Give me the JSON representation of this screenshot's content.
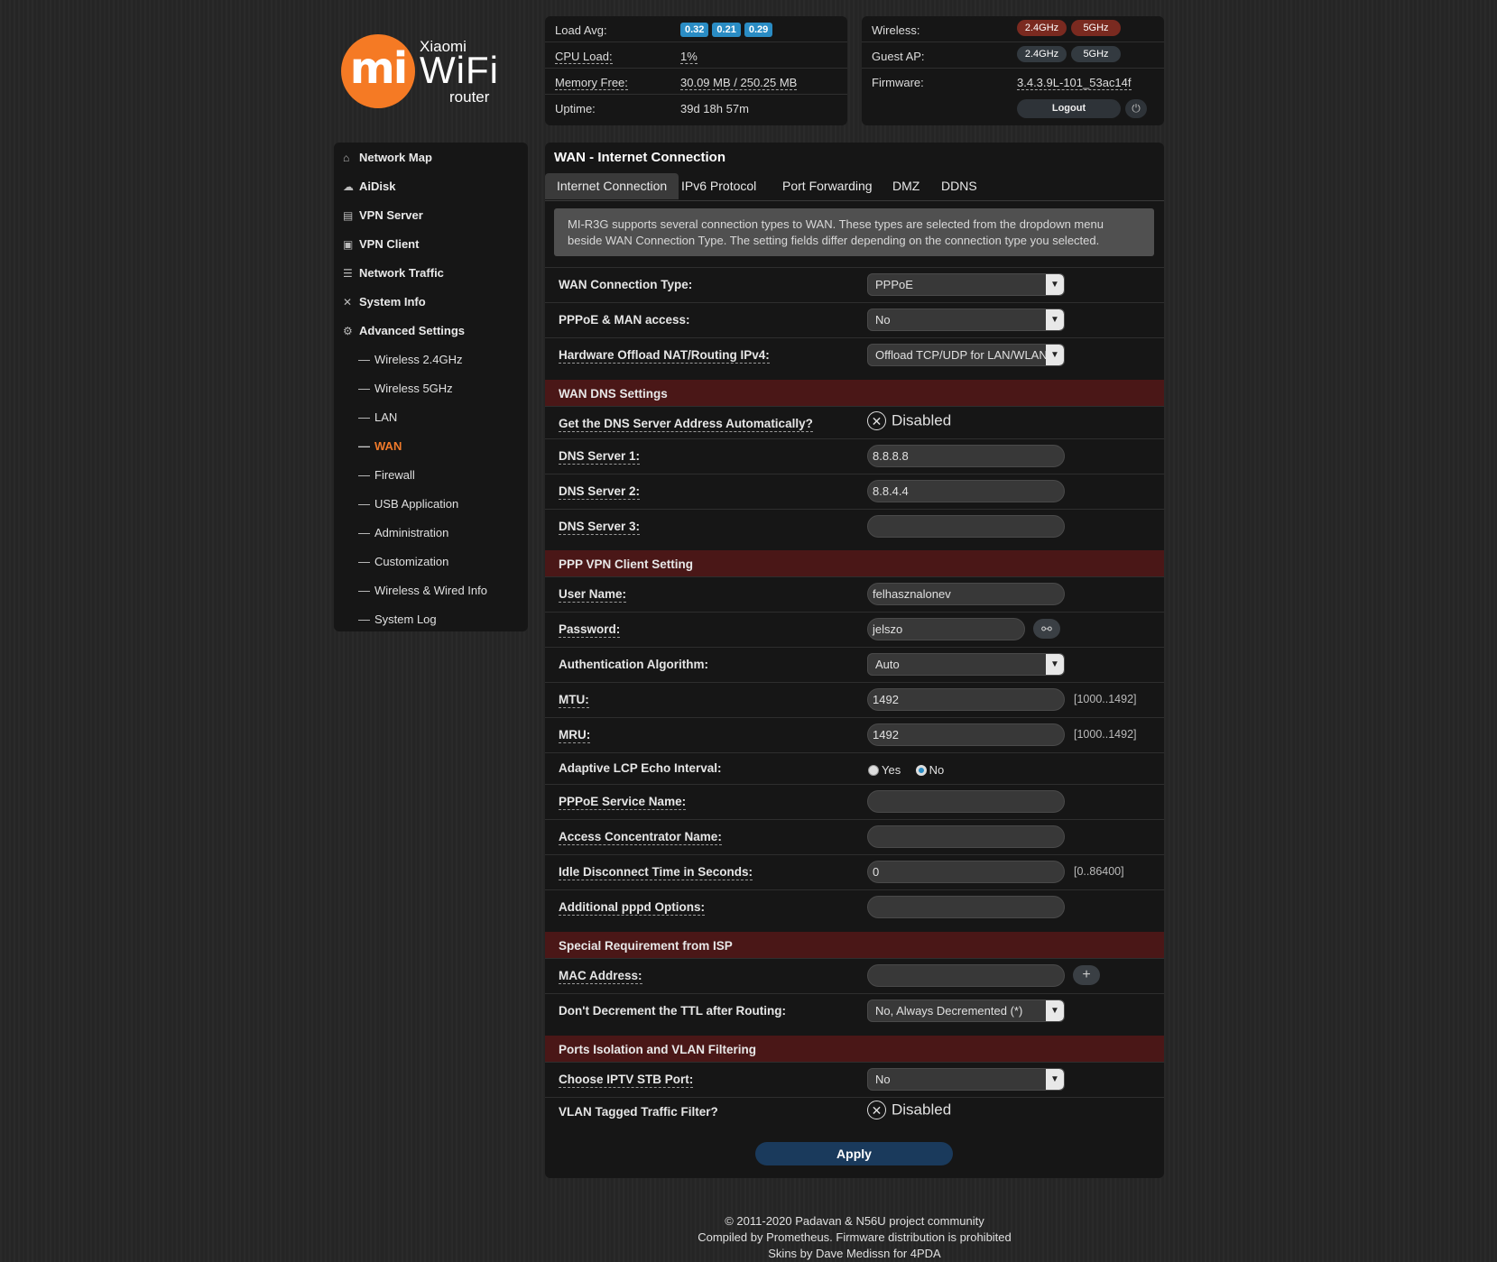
{
  "logo": {
    "mi": "mi",
    "brand_top": "Xiaomi",
    "brand_main": "WiFi",
    "brand_sub": "router"
  },
  "status": {
    "load_avg_label": "Load Avg:",
    "load_avg": [
      "0.32",
      "0.21",
      "0.29"
    ],
    "cpu_label": "CPU Load:",
    "cpu_value": "1%",
    "mem_label": "Memory Free:",
    "mem_value": "30.09 MB / 250.25 MB",
    "uptime_label": "Uptime:",
    "uptime_value": "39d 18h 57m"
  },
  "device": {
    "wireless_label": "Wireless:",
    "guest_label": "Guest AP:",
    "band_24": "2.4GHz",
    "band_5": "5GHz",
    "firmware_label": "Firmware:",
    "firmware_value": "3.4.3.9L-101_53ac14f",
    "logout": "Logout",
    "power_glyph": "⏻"
  },
  "sidebar": {
    "main": [
      {
        "label": "Network Map",
        "icon": "⌂"
      },
      {
        "label": "AiDisk",
        "icon": "☁"
      },
      {
        "label": "VPN Server",
        "icon": "▤"
      },
      {
        "label": "VPN Client",
        "icon": "▣"
      },
      {
        "label": "Network Traffic",
        "icon": "☰"
      },
      {
        "label": "System Info",
        "icon": "✕"
      },
      {
        "label": "Advanced Settings",
        "icon": "⚙"
      }
    ],
    "sub": [
      "Wireless 2.4GHz",
      "Wireless 5GHz",
      "LAN",
      "WAN",
      "Firewall",
      "USB Application",
      "Administration",
      "Customization",
      "Wireless & Wired Info",
      "System Log"
    ],
    "dash": "—"
  },
  "main": {
    "title": "WAN - Internet Connection",
    "tabs": [
      "Internet Connection",
      "IPv6 Protocol",
      "Port Forwarding",
      "DMZ",
      "DDNS"
    ],
    "info": "MI-R3G supports several connection types to WAN. These types are selected from the dropdown menu beside WAN Connection Type. The setting fields differ depending on the connection type you selected.",
    "wan_type_label": "WAN Connection Type:",
    "wan_type_value": "PPPoE",
    "man_label": "PPPoE & MAN access:",
    "man_value": "No",
    "offload_label": "Hardware Offload NAT/Routing IPv4:",
    "offload_value": "Offload TCP/UDP for LAN/WLAN",
    "sec_dns": "WAN DNS Settings",
    "dns_auto_label": "Get the DNS Server Address Automatically?",
    "dns_auto_value": "Disabled",
    "dns1_label": "DNS Server 1:",
    "dns1_value": "8.8.8.8",
    "dns2_label": "DNS Server 2:",
    "dns2_value": "8.8.4.4",
    "dns3_label": "DNS Server 3:",
    "dns3_value": "",
    "sec_ppp": "PPP VPN Client Setting",
    "user_label": "User Name:",
    "user_value": "felhasznalonev",
    "pass_label": "Password:",
    "pass_value": "jelszo",
    "auth_label": "Authentication Algorithm:",
    "auth_value": "Auto",
    "mtu_label": "MTU:",
    "mtu_value": "1492",
    "mtu_hint": "[1000..1492]",
    "mru_label": "MRU:",
    "mru_value": "1492",
    "mru_hint": "[1000..1492]",
    "lcp_label": "Adaptive LCP Echo Interval:",
    "lcp_yes": "Yes",
    "lcp_no": "No",
    "svc_label": "PPPoE Service Name:",
    "svc_value": "",
    "ac_label": "Access Concentrator Name:",
    "ac_value": "",
    "idle_label": "Idle Disconnect Time in Seconds:",
    "idle_value": "0",
    "idle_hint": "[0..86400]",
    "pppd_label": "Additional pppd Options:",
    "pppd_value": "",
    "sec_isp": "Special Requirement from ISP",
    "mac_label": "MAC Address:",
    "mac_value": "",
    "ttl_label": "Don't Decrement the TTL after Routing:",
    "ttl_value": "No, Always Decremented (*)",
    "sec_vlan": "Ports Isolation and VLAN Filtering",
    "iptv_label": "Choose IPTV STB Port:",
    "iptv_value": "No",
    "vlan_label": "VLAN Tagged Traffic Filter?",
    "vlan_value": "Disabled",
    "apply": "Apply"
  },
  "footer": {
    "line1": "© 2011-2020 Padavan & N56U project community",
    "line2": "Compiled by Prometheus. Firmware distribution is prohibited",
    "line3": "Skins by Dave Medissn for 4PDA"
  }
}
